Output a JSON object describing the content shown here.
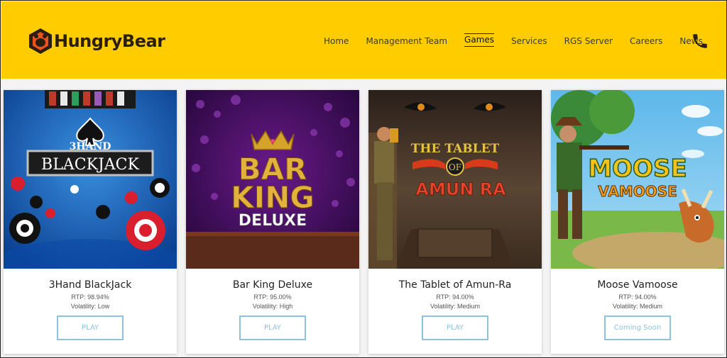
{
  "brand": {
    "name": "HungryBear",
    "accent": "#ffcc00",
    "text_color": "#2a1e12"
  },
  "nav": {
    "items": [
      {
        "label": "Home"
      },
      {
        "label": "Management Team"
      },
      {
        "label": "Games",
        "active": true
      },
      {
        "label": "Services"
      },
      {
        "label": "RGS Server"
      },
      {
        "label": "Careers"
      },
      {
        "label": "News"
      }
    ],
    "phone_icon": "phone-icon"
  },
  "games": [
    {
      "title": "3Hand BlackJack",
      "rtp": "RTP: 98.94%",
      "volatility": "Volatility: Low",
      "button": "PLAY",
      "art_text": [
        "3HAND",
        "BLACKJACK"
      ]
    },
    {
      "title": "Bar King Deluxe",
      "rtp": "RTP: 95.00%",
      "volatility": "Volatility: High",
      "button": "PLAY",
      "art_text": [
        "BAR",
        "KING",
        "DELUXE"
      ]
    },
    {
      "title": "The Tablet of Amun-Ra",
      "rtp": "RTP: 94.00%",
      "volatility": "Volatility: Medium",
      "button": "PLAY",
      "art_text": [
        "THE TABLET",
        "OF",
        "AMUN RA"
      ]
    },
    {
      "title": "Moose Vamoose",
      "rtp": "RTP: 94.00%",
      "volatility": "Volatility: Medium",
      "button": "Coming Soon",
      "art_text": [
        "MOOSE",
        "VAMOOSE"
      ]
    }
  ],
  "colors": {
    "button_border": "#8ec3dd"
  }
}
